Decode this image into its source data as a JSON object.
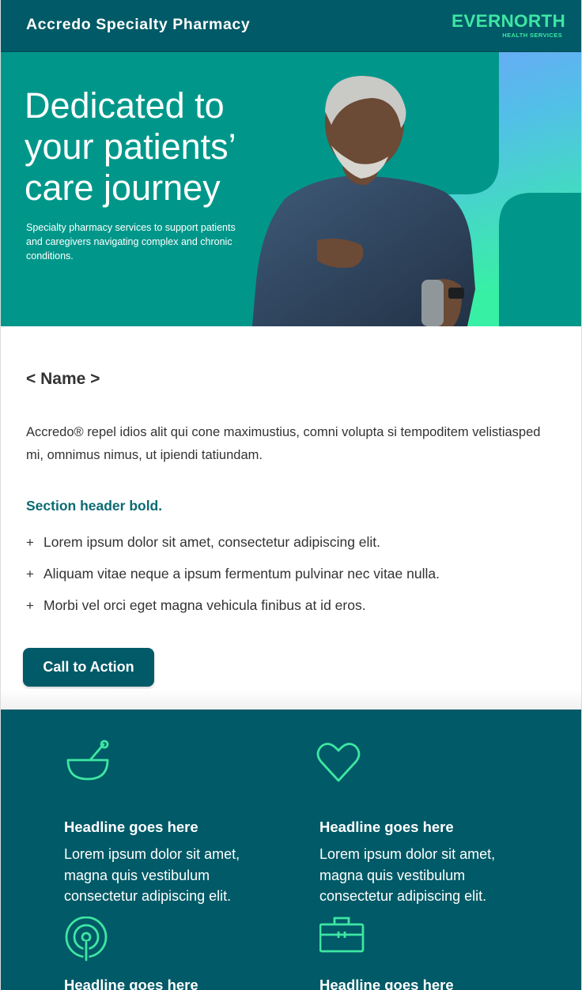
{
  "header": {
    "brand": "Accredo Specialty Pharmacy",
    "logo_word": "EVERNORTH",
    "logo_sub": "HEALTH SERVICES"
  },
  "hero": {
    "title": "Dedicated to your patients’ care journey",
    "subtitle": "Specialty pharmacy services to support patients and caregivers navigating complex and chronic conditions."
  },
  "content": {
    "greeting": "< Name >",
    "intro": "Accredo® repel idios alit qui cone maximustius, comni volupta si tempoditem velistiasped mi, omnimus nimus, ut ipiendi tatiundam.",
    "section_header": "Section header bold.",
    "bullet_marker": "+",
    "bullets": [
      "Lorem ipsum dolor sit amet, consectetur adipiscing elit.",
      "Aliquam vitae neque a ipsum fermentum pulvinar nec vitae nulla.",
      "Morbi vel orci eget magna vehicula finibus at id eros."
    ],
    "cta_label": "Call to Action"
  },
  "features": [
    {
      "icon": "mortar-pestle-icon",
      "headline": "Headline goes here",
      "text": "Lorem ipsum dolor sit amet, magna quis vestibulum consectetur adipiscing elit."
    },
    {
      "icon": "heart-icon",
      "headline": "Headline goes here",
      "text": "Lorem ipsum dolor sit amet, magna quis vestibulum consectetur adipiscing elit."
    },
    {
      "icon": "signal-location-icon",
      "headline": "Headline goes here",
      "text": ""
    },
    {
      "icon": "briefcase-icon",
      "headline": "Headline goes here",
      "text": ""
    }
  ],
  "colors": {
    "header_bg": "#005a67",
    "hero_bg": "#00978a",
    "accent_green": "#3ee6a3",
    "section_header": "#0b6a72"
  }
}
